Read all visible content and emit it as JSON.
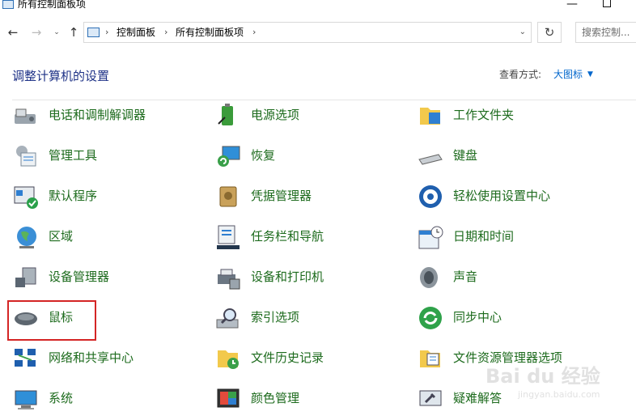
{
  "window": {
    "title": "所有控制面板项",
    "minimize": "—"
  },
  "navbar": {
    "back": "←",
    "forward": "→",
    "recent": "⌄",
    "up": "↑",
    "breadcrumbs": [
      "控制面板",
      "所有控制面板项"
    ],
    "separator": "›",
    "dropdown": "⌄",
    "refresh": "↻",
    "search_placeholder": "搜索控制..."
  },
  "header": {
    "title": "调整计算机的设置",
    "view_by_label": "查看方式:",
    "view_by_value": "大图标",
    "view_by_arrow": "▼"
  },
  "items": [
    {
      "label": "电话和调制解调器",
      "icon": "phone-modem-icon"
    },
    {
      "label": "电源选项",
      "icon": "power-options-icon"
    },
    {
      "label": "工作文件夹",
      "icon": "work-folders-icon"
    },
    {
      "label": "管理工具",
      "icon": "admin-tools-icon"
    },
    {
      "label": "恢复",
      "icon": "recovery-icon"
    },
    {
      "label": "键盘",
      "icon": "keyboard-icon"
    },
    {
      "label": "默认程序",
      "icon": "default-programs-icon"
    },
    {
      "label": "凭据管理器",
      "icon": "credential-manager-icon"
    },
    {
      "label": "轻松使用设置中心",
      "icon": "ease-of-access-icon"
    },
    {
      "label": "区域",
      "icon": "region-icon"
    },
    {
      "label": "任务栏和导航",
      "icon": "taskbar-icon"
    },
    {
      "label": "日期和时间",
      "icon": "date-time-icon"
    },
    {
      "label": "设备管理器",
      "icon": "device-manager-icon"
    },
    {
      "label": "设备和打印机",
      "icon": "devices-printers-icon"
    },
    {
      "label": "声音",
      "icon": "sound-icon"
    },
    {
      "label": "鼠标",
      "icon": "mouse-icon"
    },
    {
      "label": "索引选项",
      "icon": "indexing-options-icon"
    },
    {
      "label": "同步中心",
      "icon": "sync-center-icon"
    },
    {
      "label": "网络和共享中心",
      "icon": "network-sharing-icon"
    },
    {
      "label": "文件历史记录",
      "icon": "file-history-icon"
    },
    {
      "label": "文件资源管理器选项",
      "icon": "file-explorer-options-icon"
    },
    {
      "label": "系统",
      "icon": "system-icon"
    },
    {
      "label": "颜色管理",
      "icon": "color-management-icon"
    },
    {
      "label": "疑难解答",
      "icon": "troubleshooting-icon"
    }
  ],
  "colors": {
    "link_green": "#1d6b1d",
    "title_blue": "#1e3287",
    "highlight_red": "#d42525"
  },
  "watermark": {
    "text": "Bai du 经验",
    "sub": "jingyan.baidu.com"
  }
}
